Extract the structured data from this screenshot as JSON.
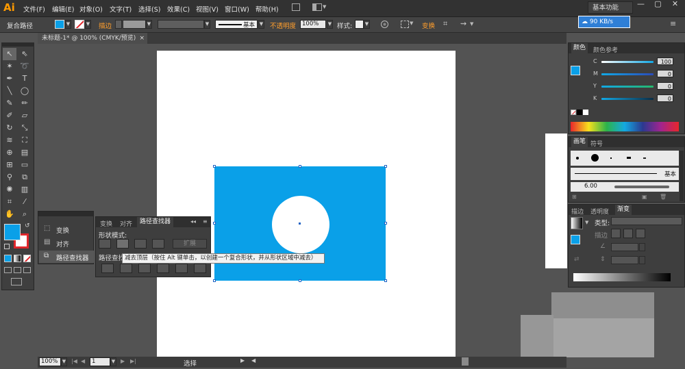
{
  "app": {
    "logo": "Ai"
  },
  "menu": [
    "文件(F)",
    "编辑(E)",
    "对象(O)",
    "文字(T)",
    "选择(S)",
    "效果(C)",
    "视图(V)",
    "窗口(W)",
    "帮助(H)"
  ],
  "workspace": {
    "label": "基本功能",
    "net_speed": "90 KB/s"
  },
  "window_controls": {
    "minimize": "—",
    "restore": "▢",
    "close": "✕"
  },
  "control_bar": {
    "object_type": "复合路径",
    "stroke_label": "描边",
    "stroke_profile": "基本",
    "opacity_label": "不透明度",
    "opacity_value": "100%",
    "style_label": "样式:",
    "transform_label": "变换",
    "fill_color": "#0aa0e8"
  },
  "document": {
    "tab_title": "未标题-1* @ 100% (CMYK/预览)",
    "close": "×"
  },
  "mini_panel": {
    "items": [
      "变换",
      "对齐",
      "路径查找器"
    ]
  },
  "pathfinder": {
    "tabs": [
      "变换",
      "对齐",
      "路径查找器"
    ],
    "shape_modes_label": "形状模式:",
    "expand_label": "扩展",
    "pathfinders_label": "路径查找器:",
    "tooltip": "减去顶层（按住 Alt 键单击，以创建一个复合形状，并从形状区域中减去）"
  },
  "color_panel": {
    "tabs": [
      "颜色",
      "颜色参考"
    ],
    "channels": [
      {
        "name": "C",
        "value": "100",
        "color": "#12a9e6"
      },
      {
        "name": "M",
        "value": "0",
        "color": "#2a87c9"
      },
      {
        "name": "Y",
        "value": "0",
        "color": "#25b86c"
      },
      {
        "name": "K",
        "value": "0",
        "color": "#1d8fd1"
      }
    ]
  },
  "brush_panel": {
    "tabs": [
      "画笔",
      "符号"
    ],
    "basic_label": "基本",
    "size_label": "6.00"
  },
  "gradient_panel": {
    "tabs": [
      "描边",
      "透明度",
      "渐变"
    ],
    "type_label": "类型:",
    "stroke_label": "描边"
  },
  "status": {
    "zoom": "100%",
    "page": "1",
    "mode": "选择"
  },
  "colors": {
    "fill": "#0aa0e8",
    "accent": "#ff9e2c"
  }
}
